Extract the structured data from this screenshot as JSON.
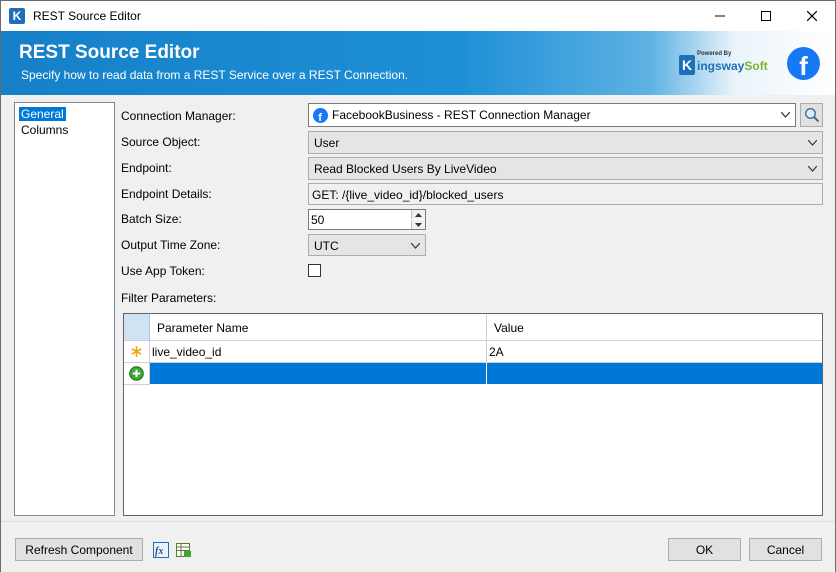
{
  "window": {
    "title": "REST Source Editor"
  },
  "banner": {
    "title": "REST Source Editor",
    "subtitle": "Specify how to read data from a REST Service over a REST Connection.",
    "logo_powered": "Powered By",
    "logo_name_a": "ingsway",
    "logo_name_b": "Soft"
  },
  "nav": {
    "items": [
      {
        "label": "General"
      },
      {
        "label": "Columns"
      }
    ]
  },
  "form": {
    "connection_manager": {
      "label": "Connection Manager:",
      "value": "FacebookBusiness - REST Connection Manager"
    },
    "source_object": {
      "label": "Source Object:",
      "value": "User"
    },
    "endpoint": {
      "label": "Endpoint:",
      "value": "Read Blocked Users By LiveVideo"
    },
    "endpoint_details": {
      "label": "Endpoint Details:",
      "value": "GET: /{live_video_id}/blocked_users"
    },
    "batch_size": {
      "label": "Batch Size:",
      "value": "50"
    },
    "output_time_zone": {
      "label": "Output Time Zone:",
      "value": "UTC"
    },
    "use_app_token": {
      "label": "Use App Token:"
    },
    "filter_parameters": {
      "label": "Filter Parameters:"
    }
  },
  "grid": {
    "columns": [
      "Parameter Name",
      "Value"
    ],
    "rows": [
      {
        "name": "live_video_id",
        "value": "2A"
      }
    ]
  },
  "buttons": {
    "refresh": "Refresh Component",
    "ok": "OK",
    "cancel": "Cancel"
  },
  "colors": {
    "accent": "#0078d7",
    "banner": "#1580c8",
    "facebook": "#1877f2"
  }
}
